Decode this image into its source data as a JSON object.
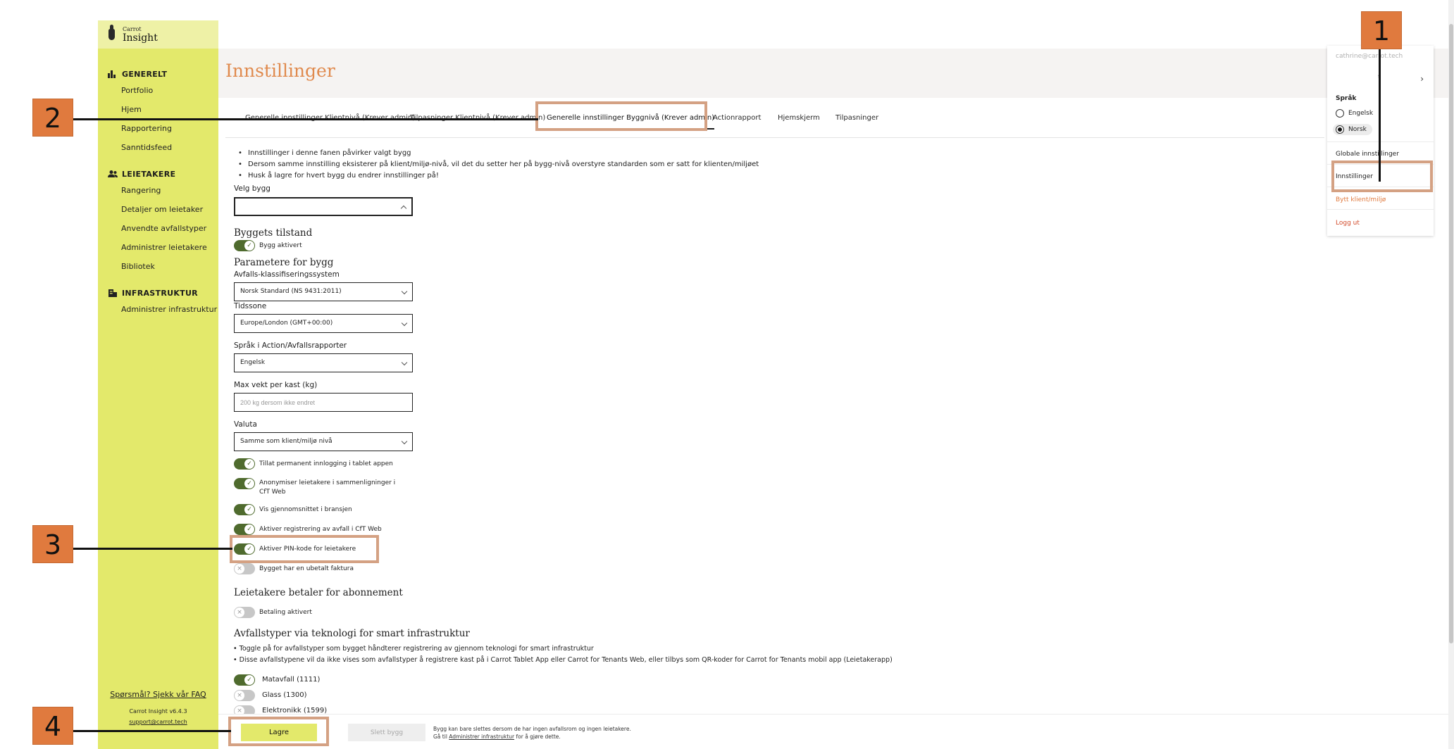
{
  "app": {
    "logo_small": "Carrot",
    "logo_big": "Insight"
  },
  "sidebar": {
    "sections": [
      {
        "title": "GENERELT",
        "items": [
          "Portfolio",
          "Hjem",
          "Rapportering",
          "Sanntidsfeed"
        ]
      },
      {
        "title": "LEIETAKERE",
        "items": [
          "Rangering",
          "Detaljer om leietaker",
          "Anvendte avfallstyper",
          "Administrer leietakere",
          "Bibliotek"
        ]
      },
      {
        "title": "INFRASTRUKTUR",
        "items": [
          "Administrer infrastruktur"
        ]
      }
    ],
    "faq": "Spørsmål? Sjekk vår FAQ",
    "version": "Carrot Insight v6.4.3",
    "support_email": "support@carrot.tech"
  },
  "page": {
    "title": "Innstillinger"
  },
  "tabs": [
    "Generelle innstillinger Klientnivå (Krever admin)",
    "Tilpasninger Klientnivå (Krever admin)",
    "Generelle innstillinger Byggnivå (Krever admin)",
    "Actionrapport",
    "Hjemskjerm",
    "Tilpasninger"
  ],
  "info_bullets": [
    "Innstillinger i denne fanen påvirker valgt bygg",
    "Dersom samme innstilling eksisterer på klient/miljø-nivå, vil det du setter her på bygg-nivå overstyre standarden som er satt for klienten/miljøet",
    "Husk å lagre for hvert bygg du endrer innstillinger på!"
  ],
  "form": {
    "select_building_label": "Velg bygg",
    "select_building_value": "",
    "building_state_heading": "Byggets tilstand",
    "building_active": "Bygg aktivert",
    "params_heading": "Parametere for bygg",
    "classification_label": "Avfalls-klassifiseringssystem",
    "classification_value": "Norsk Standard (NS 9431:2011)",
    "timezone_label": "Tidssone",
    "timezone_value": "Europe/London (GMT+00:00)",
    "report_lang_label": "Språk i Action/Avfallsrapporter",
    "report_lang_value": "Engelsk",
    "max_weight_label": "Max vekt per kast (kg)",
    "max_weight_placeholder": "200 kg dersom ikke endret",
    "currency_label": "Valuta",
    "currency_value": "Samme som klient/miljø nivå",
    "toggles": [
      {
        "label": "Tillat permanent innlogging i tablet appen",
        "on": true
      },
      {
        "label": "Anonymiser leietakere i sammenligninger i CfT Web",
        "on": true
      },
      {
        "label": "Vis gjennomsnittet i bransjen",
        "on": true
      },
      {
        "label": "Aktiver registrering av avfall i CfT Web",
        "on": true
      },
      {
        "label": "Aktiver PIN-kode for leietakere",
        "on": true
      },
      {
        "label": "Bygget har en ubetalt faktura",
        "on": false
      }
    ],
    "subscription_heading": "Leietakere betaler for abonnement",
    "payment_active": "Betaling aktivert",
    "smart_heading": "Avfallstyper via teknologi for smart infrastruktur",
    "smart_bullets": [
      "Toggle på for avfallstyper som bygget håndterer registrering av gjennom teknologi for smart infrastruktur",
      "Disse avfallstypene vil da ikke vises som avfallstyper å registrere kast på i Carrot Tablet App eller Carrot for Tenants Web, eller tilbys som QR-koder for Carrot for Tenants mobil app (Leietakerapp)"
    ],
    "waste_types": [
      {
        "label": "Matavfall (1111)",
        "on": true
      },
      {
        "label": "Glass (1300)",
        "on": false
      },
      {
        "label": "Elektronikk (1599)",
        "on": false
      }
    ]
  },
  "footer": {
    "save": "Lagre",
    "delete": "Slett bygg",
    "note_line1": "Bygg kan bare slettes dersom de har ingen avfallsrom og ingen leietakere.",
    "note_line2_pre": "Gå til",
    "note_link": "Administrer infrastruktur",
    "note_line2_post": "for å gjøre dette."
  },
  "menu": {
    "email": "cathrine@carrot.tech",
    "lang_heading": "Språk",
    "lang_options": [
      "Engelsk",
      "Norsk"
    ],
    "selected_lang": "Norsk",
    "global_settings": "Globale innstillinger",
    "settings": "Innstillinger",
    "switch_client": "Bytt klient/miljø",
    "logout": "Logg ut"
  },
  "annotations": {
    "b1": "1",
    "b2": "2",
    "b3": "3",
    "b4": "4"
  },
  "colors": {
    "sidebar": "#e3e96b",
    "accent_orange": "#e07a3e",
    "toggle_on": "#4f6b2e",
    "annotation_box": "#d4a183"
  }
}
